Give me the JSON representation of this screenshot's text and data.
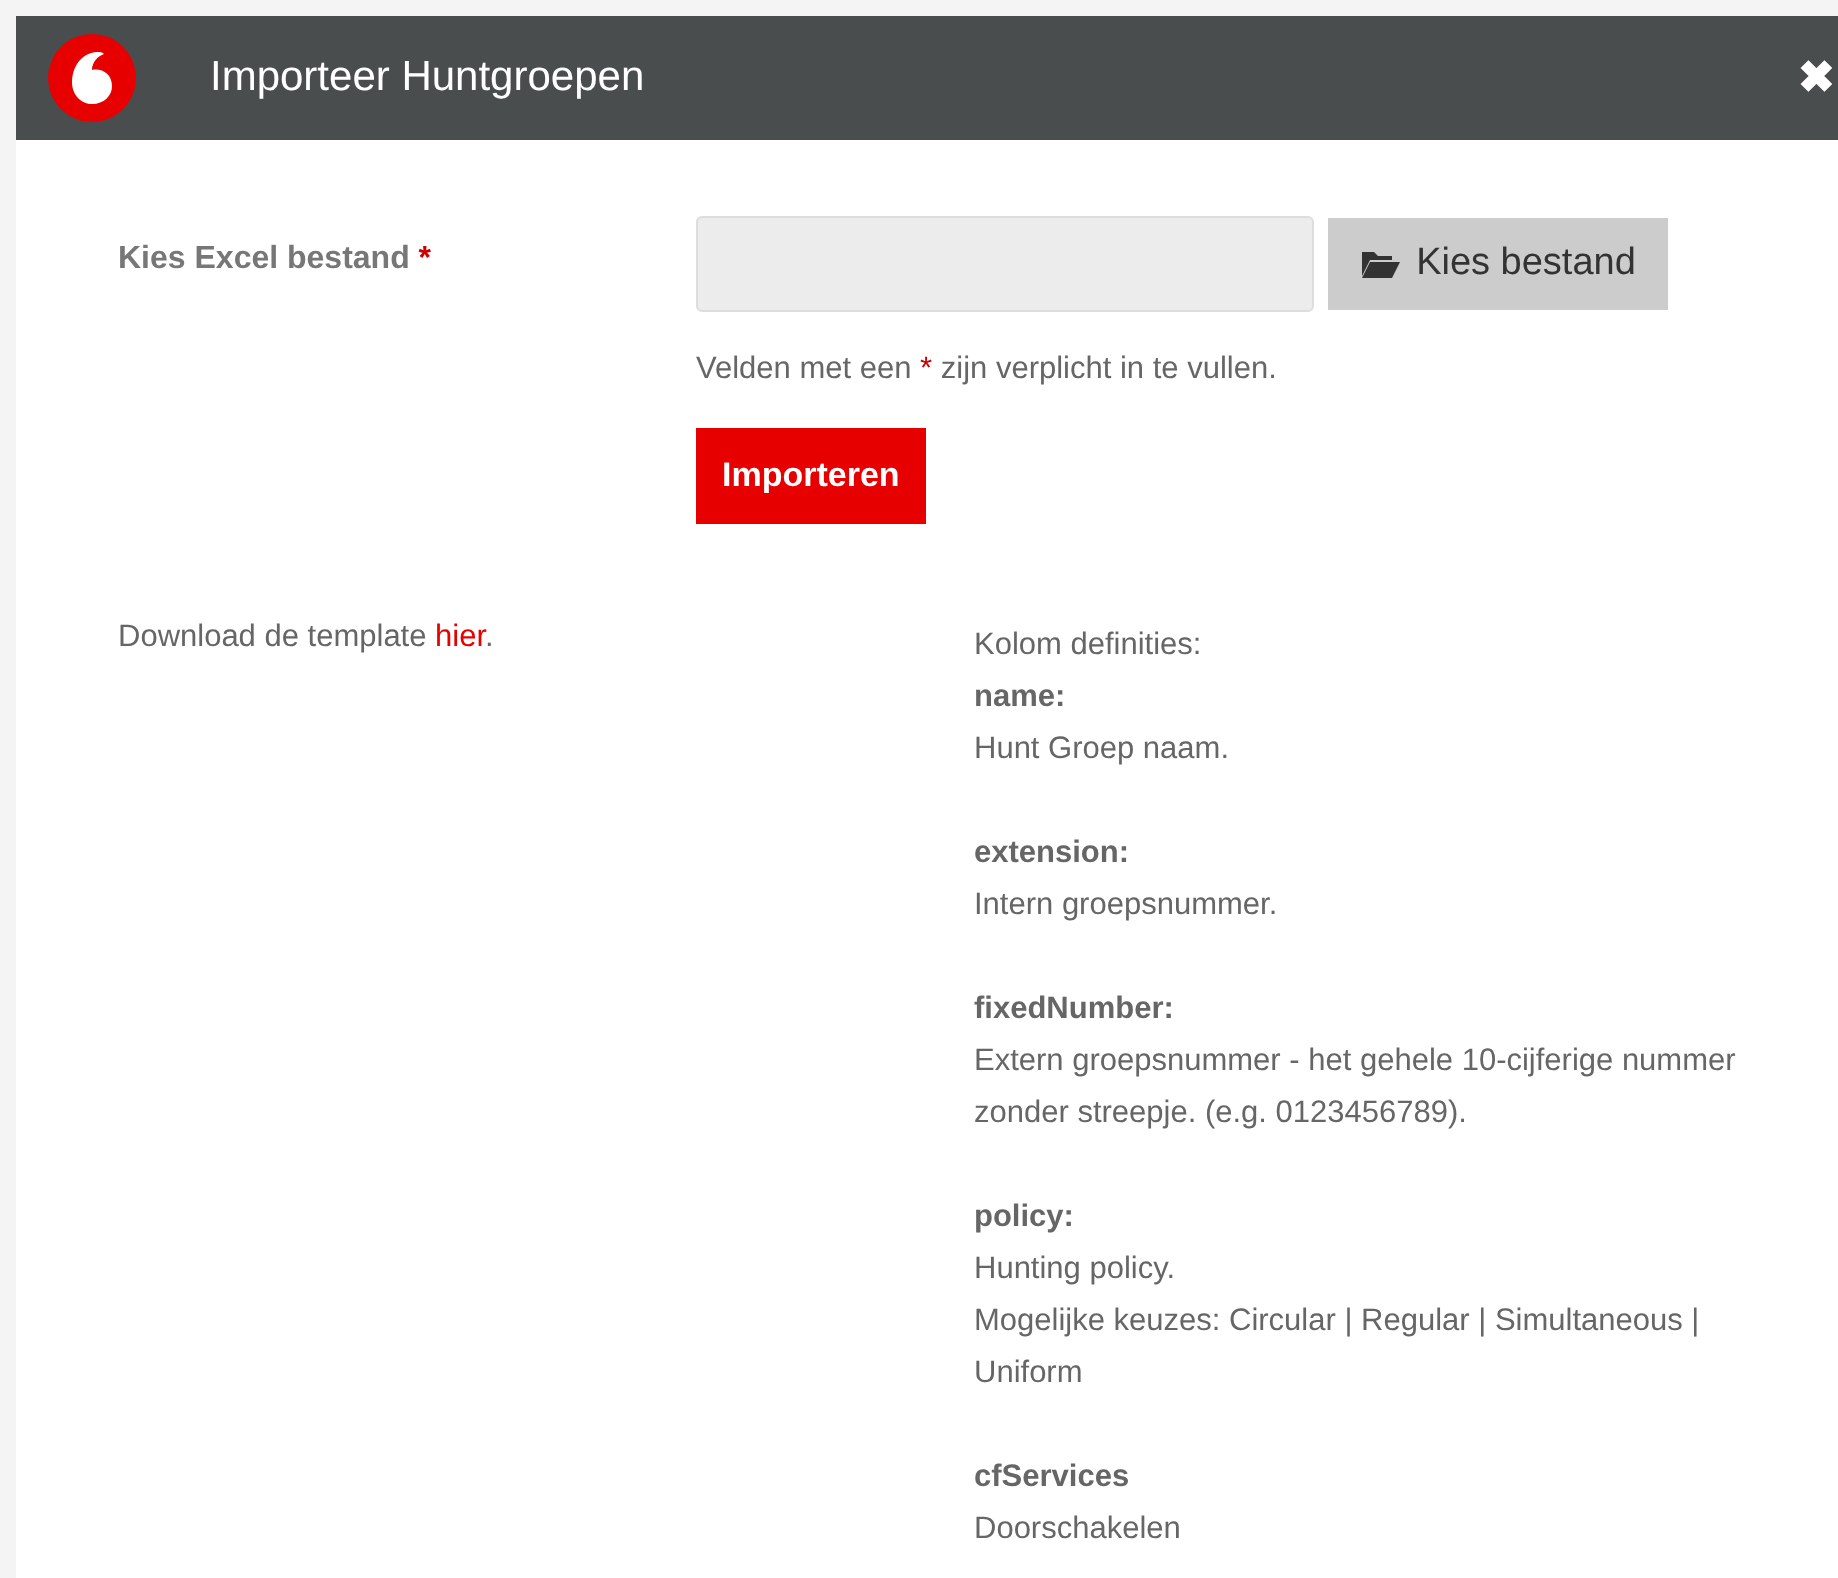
{
  "dialog": {
    "title": "Importeer Huntgroepen",
    "close": "✖"
  },
  "file_field": {
    "label": "Kies Excel bestand",
    "required_mark": "*",
    "button": "Kies bestand"
  },
  "hint": {
    "before": "Velden met een",
    "mark": "*",
    "after": "zijn verplicht in te vullen."
  },
  "import_button": "Importeren",
  "download": {
    "before": "Download de template",
    "link": "hier",
    "after": "."
  },
  "definitions": {
    "heading": "Kolom definities:",
    "items": [
      {
        "term": "name:",
        "lines": [
          "Hunt Groep naam."
        ]
      },
      {
        "term": "extension:",
        "lines": [
          "Intern groepsnummer."
        ]
      },
      {
        "term": "fixedNumber:",
        "lines": [
          "Extern groepsnummer - het gehele 10-cijferige nummer zonder streepje. (e.g. 0123456789)."
        ]
      },
      {
        "term": "policy:",
        "lines": [
          "Hunting policy.",
          "Mogelijke keuzes: Circular | Regular | Simultaneous | Uniform"
        ]
      },
      {
        "term": "cfServices",
        "lines": [
          "Doorschakelen"
        ]
      }
    ]
  }
}
